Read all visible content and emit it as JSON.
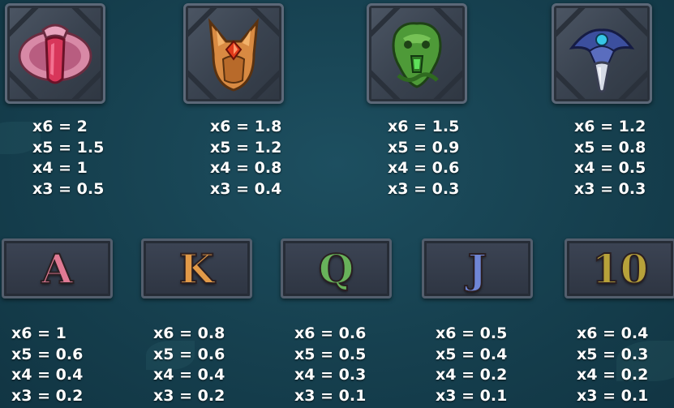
{
  "premium_symbols": [
    {
      "name": "pink-gem-amulet",
      "pays": [
        "x6 = 2",
        "x5 = 1.5",
        "x4 = 1",
        "x3 = 0.5"
      ]
    },
    {
      "name": "orange-fox-mask",
      "pays": [
        "x6 = 1.8",
        "x5 = 1.2",
        "x4 = 0.8",
        "x3 = 0.4"
      ]
    },
    {
      "name": "green-serpent-idol",
      "pays": [
        "x6 = 1.5",
        "x5 = 0.9",
        "x4 = 0.6",
        "x3 = 0.3"
      ]
    },
    {
      "name": "blue-raven-skull",
      "pays": [
        "x6 = 1.2",
        "x5 = 0.8",
        "x4 = 0.5",
        "x3 = 0.3"
      ]
    }
  ],
  "royal_symbols": [
    {
      "letter": "A",
      "color": "#e07a94",
      "pays": [
        "x6 = 1",
        "x5 = 0.6",
        "x4 = 0.4",
        "x3 = 0.2"
      ]
    },
    {
      "letter": "K",
      "color": "#e29a48",
      "pays": [
        "x6 = 0.8",
        "x5 = 0.6",
        "x4 = 0.4",
        "x3 = 0.2"
      ]
    },
    {
      "letter": "Q",
      "color": "#68b25a",
      "pays": [
        "x6 = 0.6",
        "x5 = 0.5",
        "x4 = 0.3",
        "x3 = 0.1"
      ]
    },
    {
      "letter": "J",
      "color": "#6f86d6",
      "pays": [
        "x6 = 0.5",
        "x5 = 0.4",
        "x4 = 0.2",
        "x3 = 0.1"
      ]
    },
    {
      "letter": "10",
      "color": "#b8a23a",
      "pays": [
        "x6 = 0.4",
        "x5 = 0.3",
        "x4 = 0.2",
        "x3 = 0.1"
      ]
    }
  ]
}
